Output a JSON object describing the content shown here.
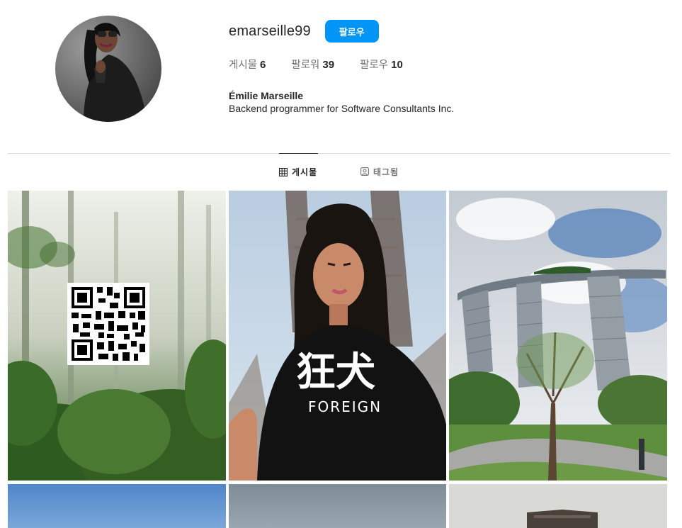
{
  "profile": {
    "username": "emarseille99",
    "follow_label": "팔로우",
    "stats": [
      {
        "label": "게시물",
        "value": "6"
      },
      {
        "label": "팔로워",
        "value": "39"
      },
      {
        "label": "팔로우",
        "value": "10"
      }
    ],
    "full_name": "Émilie Marseille",
    "bio": "Backend programmer for Software Consultants Inc."
  },
  "tabs": {
    "posts_label": "게시물",
    "tagged_label": "태그됨",
    "active": "posts"
  },
  "posts": [
    {
      "subject": "misty forest with QR code"
    },
    {
      "subject": "woman in black FOREIGN t-shirt"
    },
    {
      "subject": "towers with rooftop park"
    },
    {
      "subject": "blue sky"
    },
    {
      "subject": "grey sky"
    },
    {
      "subject": "building"
    }
  ],
  "posts_text": {
    "tshirt_kanji": "狂犬",
    "tshirt_word": "FOREIGN"
  },
  "colors": {
    "accent": "#0095f6",
    "text": "#262626",
    "muted": "#737373",
    "divider": "#dbdbdb"
  }
}
